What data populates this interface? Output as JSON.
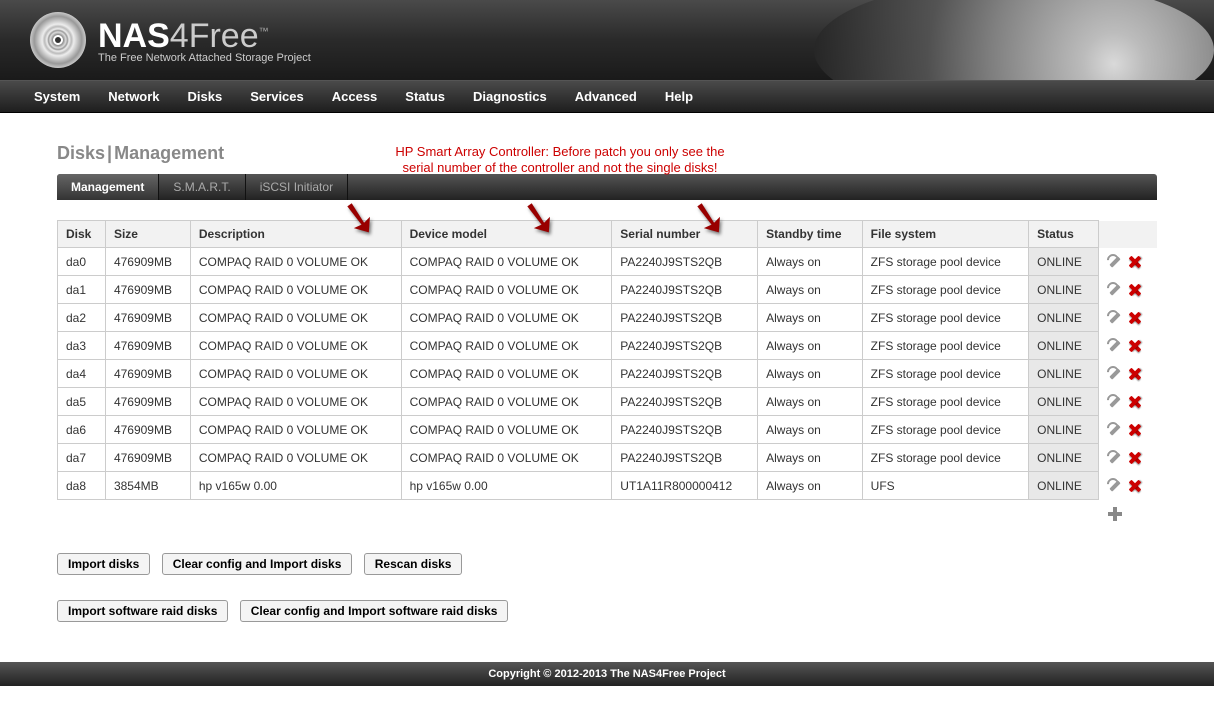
{
  "brand": {
    "name_bold": "NAS",
    "name_thin": "4Free",
    "trademark": "™",
    "tagline": "The Free Network Attached Storage Project"
  },
  "nav": [
    "System",
    "Network",
    "Disks",
    "Services",
    "Access",
    "Status",
    "Diagnostics",
    "Advanced",
    "Help"
  ],
  "page": {
    "title_a": "Disks",
    "title_sep": "|",
    "title_b": "Management"
  },
  "annotation": {
    "line1": "HP Smart Array Controller: Before patch you only see the",
    "line2": "serial number of the controller and not the single disks!"
  },
  "tabs": [
    {
      "label": "Management",
      "active": true
    },
    {
      "label": "S.M.A.R.T.",
      "active": false
    },
    {
      "label": "iSCSI Initiator",
      "active": false
    }
  ],
  "columns": [
    "Disk",
    "Size",
    "Description",
    "Device model",
    "Serial number",
    "Standby time",
    "File system",
    "Status"
  ],
  "rows": [
    {
      "disk": "da0",
      "size": "476909MB",
      "desc": "COMPAQ RAID 0 VOLUME OK",
      "model": "COMPAQ RAID 0 VOLUME OK",
      "serial": "PA2240J9STS2QB",
      "standby": "Always on",
      "fs": "ZFS storage pool device",
      "status": "ONLINE"
    },
    {
      "disk": "da1",
      "size": "476909MB",
      "desc": "COMPAQ RAID 0 VOLUME OK",
      "model": "COMPAQ RAID 0 VOLUME OK",
      "serial": "PA2240J9STS2QB",
      "standby": "Always on",
      "fs": "ZFS storage pool device",
      "status": "ONLINE"
    },
    {
      "disk": "da2",
      "size": "476909MB",
      "desc": "COMPAQ RAID 0 VOLUME OK",
      "model": "COMPAQ RAID 0 VOLUME OK",
      "serial": "PA2240J9STS2QB",
      "standby": "Always on",
      "fs": "ZFS storage pool device",
      "status": "ONLINE"
    },
    {
      "disk": "da3",
      "size": "476909MB",
      "desc": "COMPAQ RAID 0 VOLUME OK",
      "model": "COMPAQ RAID 0 VOLUME OK",
      "serial": "PA2240J9STS2QB",
      "standby": "Always on",
      "fs": "ZFS storage pool device",
      "status": "ONLINE"
    },
    {
      "disk": "da4",
      "size": "476909MB",
      "desc": "COMPAQ RAID 0 VOLUME OK",
      "model": "COMPAQ RAID 0 VOLUME OK",
      "serial": "PA2240J9STS2QB",
      "standby": "Always on",
      "fs": "ZFS storage pool device",
      "status": "ONLINE"
    },
    {
      "disk": "da5",
      "size": "476909MB",
      "desc": "COMPAQ RAID 0 VOLUME OK",
      "model": "COMPAQ RAID 0 VOLUME OK",
      "serial": "PA2240J9STS2QB",
      "standby": "Always on",
      "fs": "ZFS storage pool device",
      "status": "ONLINE"
    },
    {
      "disk": "da6",
      "size": "476909MB",
      "desc": "COMPAQ RAID 0 VOLUME OK",
      "model": "COMPAQ RAID 0 VOLUME OK",
      "serial": "PA2240J9STS2QB",
      "standby": "Always on",
      "fs": "ZFS storage pool device",
      "status": "ONLINE"
    },
    {
      "disk": "da7",
      "size": "476909MB",
      "desc": "COMPAQ RAID 0 VOLUME OK",
      "model": "COMPAQ RAID 0 VOLUME OK",
      "serial": "PA2240J9STS2QB",
      "standby": "Always on",
      "fs": "ZFS storage pool device",
      "status": "ONLINE"
    },
    {
      "disk": "da8",
      "size": "3854MB",
      "desc": "hp v165w 0.00",
      "model": "hp v165w 0.00",
      "serial": "UT1A11R800000412",
      "standby": "Always on",
      "fs": "UFS",
      "status": "ONLINE"
    }
  ],
  "buttons": {
    "import_disks": "Import disks",
    "clear_import": "Clear config and Import disks",
    "rescan": "Rescan disks",
    "import_swraid": "Import software raid disks",
    "clear_import_swraid": "Clear config and Import software raid disks"
  },
  "footer": "Copyright © 2012-2013 The NAS4Free Project"
}
